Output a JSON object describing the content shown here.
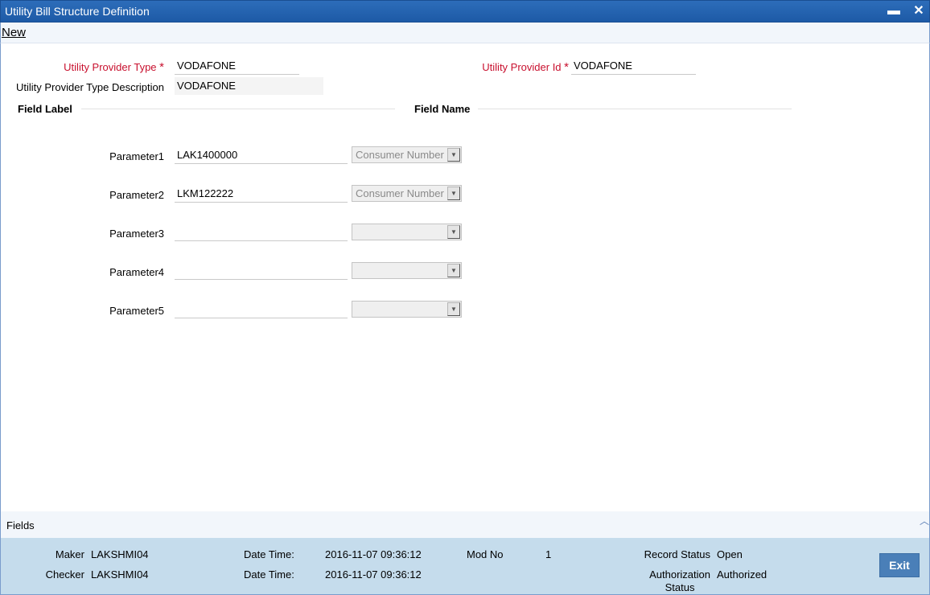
{
  "window": {
    "title": "Utility Bill Structure Definition",
    "minimize_label": "▬",
    "close_label": "✕"
  },
  "menu": {
    "new_label": "New"
  },
  "form": {
    "provider_type_label": "Utility Provider Type",
    "provider_type_value": "VODAFONE",
    "provider_id_label": "Utility Provider Id",
    "provider_id_value": "VODAFONE",
    "provider_desc_label": "Utility Provider Type Description",
    "provider_desc_value": "VODAFONE",
    "required_mark": "*"
  },
  "sections": {
    "field_label": "Field Label",
    "field_name": "Field Name"
  },
  "parameters": [
    {
      "label": "Parameter1",
      "value": "LAK1400000",
      "select": "Consumer Number"
    },
    {
      "label": "Parameter2",
      "value": "LKM122222",
      "select": "Consumer Number"
    },
    {
      "label": "Parameter3",
      "value": "",
      "select": ""
    },
    {
      "label": "Parameter4",
      "value": "",
      "select": ""
    },
    {
      "label": "Parameter5",
      "value": "",
      "select": ""
    }
  ],
  "select_arrow": "▼",
  "fields_bar": {
    "label": "Fields",
    "caret": "︿"
  },
  "footer": {
    "maker_label": "Maker",
    "maker_value": "LAKSHMI04",
    "checker_label": "Checker",
    "checker_value": "LAKSHMI04",
    "date_time_label": "Date Time:",
    "maker_datetime": "2016-11-07 09:36:12",
    "checker_datetime": "2016-11-07 09:36:12",
    "mod_no_label": "Mod No",
    "mod_no_value": "1",
    "record_status_label": "Record Status",
    "record_status_value": "Open",
    "auth_status_label_1": "Authorization",
    "auth_status_label_2": "Status",
    "auth_status_value": "Authorized",
    "exit_label": "Exit"
  },
  "colors": {
    "title_bar": "#1d5aa6",
    "required": "#c8102e",
    "footer_bg": "#c5dcec",
    "exit_button": "#4a7fb8"
  }
}
